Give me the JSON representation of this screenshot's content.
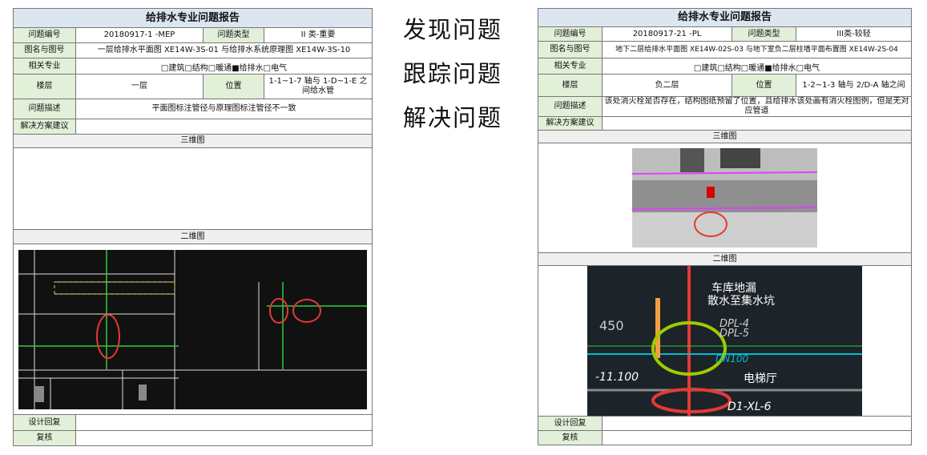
{
  "slogans": [
    "发现问题",
    "跟踪问题",
    "解决问题"
  ],
  "labels": {
    "title": "给排水专业问题报告",
    "id": "问题编号",
    "type": "问题类型",
    "drawing": "图名与图号",
    "discipline": "相关专业",
    "floor": "楼层",
    "location": "位置",
    "desc": "问题描述",
    "solution": "解决方案建议",
    "view3d": "三维图",
    "view2d": "二维图",
    "reply": "设计回复",
    "review": "复核"
  },
  "left": {
    "id": "20180917-1 -MEP",
    "type": "II 类-重要",
    "drawing": "一层给排水平面图 XE14W-3S-01 与给排水系统原理图 XE14W-3S-10",
    "discipline": "□建筑□结构□暖通■给排水□电气",
    "floor": "一层",
    "location": "1-1~1-7 轴与 1-D~1-E 之间给水管",
    "desc": "平面图标注管径与原理图标注管径不一致",
    "solution": "",
    "reply": "",
    "review": ""
  },
  "right": {
    "id": "20180917-21 -PL",
    "type": "III类-较轻",
    "drawing": "地下二层给排水平面图 XE14W-02S-03 与地下室负二层柱墙平面布置图 XE14W-2S-04",
    "discipline": "□建筑□结构□暖通■给排水□电气",
    "floor": "负二层",
    "location": "1-2~1-3 轴与 2/D-A 轴之间",
    "desc": "该处消火栓是否存在，结构图纸预留了位置，且给排水该处画有消火栓图例，但是无对应管道",
    "solution": "",
    "reply": "",
    "review": "",
    "cad": {
      "t1": "车库地漏",
      "t2": "散水至集水坑",
      "t3": "DPL-4",
      "t4": "DPL-5",
      "t5": "DN100",
      "t6": "-11.100",
      "t7": "电梯厅",
      "t8": "D1-XL-6",
      "t9": "450"
    }
  },
  "colors": {
    "title_bg": "#dce6f1",
    "label_bg": "#e2efd9",
    "highlight": "#e53935"
  }
}
